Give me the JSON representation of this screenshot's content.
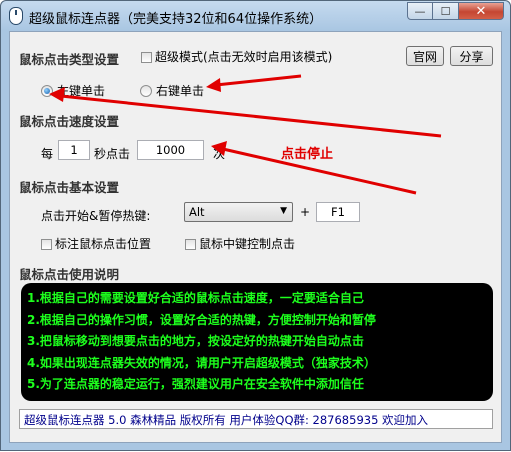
{
  "window": {
    "title": "超级鼠标连点器（完美支持32位和64位操作系统）",
    "caption_min": "—",
    "caption_max": "☐",
    "caption_close": "✕"
  },
  "click_type": {
    "section_title": "鼠标点击类型设置",
    "super_mode_label": "超级模式(点击无效时启用该模式)",
    "super_mode_checked": false,
    "official_button": "官网",
    "share_button": "分享",
    "left_click_label": "左键单击",
    "right_click_label": "右键单击",
    "selected": "left"
  },
  "speed": {
    "section_title": "鼠标点击速度设置",
    "every_label": "每",
    "seconds_value": "1",
    "seconds_unit_label": "秒点击",
    "clicks_value": "1000",
    "times_unit_label": "次",
    "stop_status": "点击停止"
  },
  "basic": {
    "section_title": "鼠标点击基本设置",
    "hotkey_label": "点击开始&暂停热键:",
    "modifier_selected": "Alt",
    "plus_label": "+",
    "key_value": "F1",
    "mark_position_label": "标注鼠标点击位置",
    "mark_position_checked": false,
    "middle_key_label": "鼠标中键控制点击",
    "middle_key_checked": false
  },
  "instructions": {
    "section_title": "鼠标点击使用说明",
    "lines": [
      "1.根据自己的需要设置好合适的鼠标点击速度，一定要适合自己",
      "2.根据自己的操作习惯，设置好合适的热键，方便控制开始和暂停",
      "3.把鼠标移动到想要点击的地方，按设定好的热键开始自动点击",
      "4.如果出现连点器失效的情况，请用户开启超级模式（独家技术）",
      "5.为了连点器的稳定运行，强烈建议用户在安全软件中添加信任"
    ]
  },
  "status": {
    "text": "超级鼠标连点器 5.0 森林精品 版权所有 用户体验QQ群: 287685935 欢迎加入"
  },
  "colors": {
    "arrow_red": "#e00000",
    "instruction_text": "#1dff1d",
    "status_text": "#00008b"
  }
}
